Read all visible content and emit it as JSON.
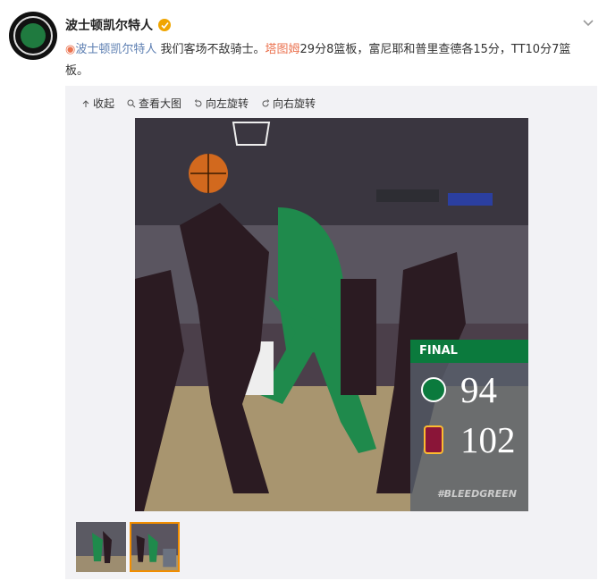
{
  "account": {
    "name": "波士顿凯尔特人"
  },
  "post": {
    "mention": "波士顿凯尔特人",
    "text_1": "我们客场不敌骑士。",
    "link": "塔图姆",
    "text_2": "29分8篮板，富尼耶和普里查德各15分，TT10分7篮板。"
  },
  "toolbar": {
    "collapse": "收起",
    "view_large": "查看大图",
    "rotate_left": "向左旋转",
    "rotate_right": "向右旋转"
  },
  "scoreboard": {
    "label": "FINAL",
    "celtics_score": "94",
    "cavs_score": "102",
    "hashtag": "#BLEEDGREEN"
  },
  "colors": {
    "celtics_green": "#0b7a3d",
    "cavs_wine": "#8a1538",
    "link_blue": "#5d7fb2",
    "mention_orange": "#eb7350",
    "thumb_select": "#f18d00"
  }
}
